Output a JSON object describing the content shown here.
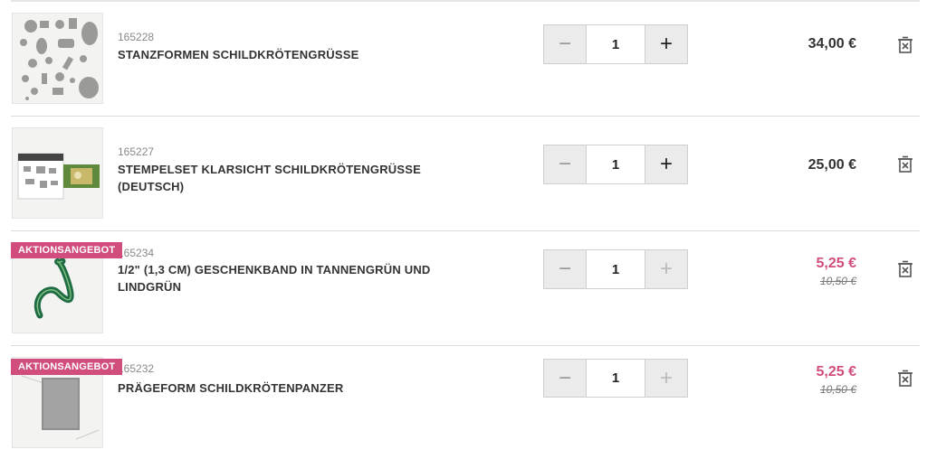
{
  "cart": {
    "items": [
      {
        "sku": "165228",
        "name": "STANZFORMEN SCHILDKRÖTENGRÜSSE",
        "badge": "",
        "quantity": "1",
        "price": "34,00 €",
        "old_price": "",
        "image": "stanzformen-dies-image"
      },
      {
        "sku": "165227",
        "name": "STEMPELSET KLARSICHT SCHILDKRÖTENGRÜSSE (DEUTSCH)",
        "badge": "",
        "quantity": "1",
        "price": "25,00 €",
        "old_price": "",
        "image": "stempelset-image"
      },
      {
        "sku": "165234",
        "name": "1/2\" (1,3 CM) GESCHENKBAND IN TANNENGRÜN UND LINDGRÜN",
        "badge": "AKTIONSANGEBOT",
        "quantity": "1",
        "price": "5,25 €",
        "old_price": "10,50 €",
        "image": "ribbon-image"
      },
      {
        "sku": "165232",
        "name": "PRÄGEFORM SCHILDKRÖTENPANZER",
        "badge": "AKTIONSANGEBOT",
        "quantity": "1",
        "price": "5,25 €",
        "old_price": "10,50 €",
        "image": "embossing-folder-image"
      }
    ],
    "minus_symbol": "−",
    "plus_symbol": "+",
    "icons": {
      "minus": "minus-icon",
      "plus": "plus-icon",
      "remove": "trash-icon"
    },
    "colors": {
      "sale": "#d14d7e",
      "badge": "#d14d7e",
      "stepper": "#ebebeb"
    }
  }
}
